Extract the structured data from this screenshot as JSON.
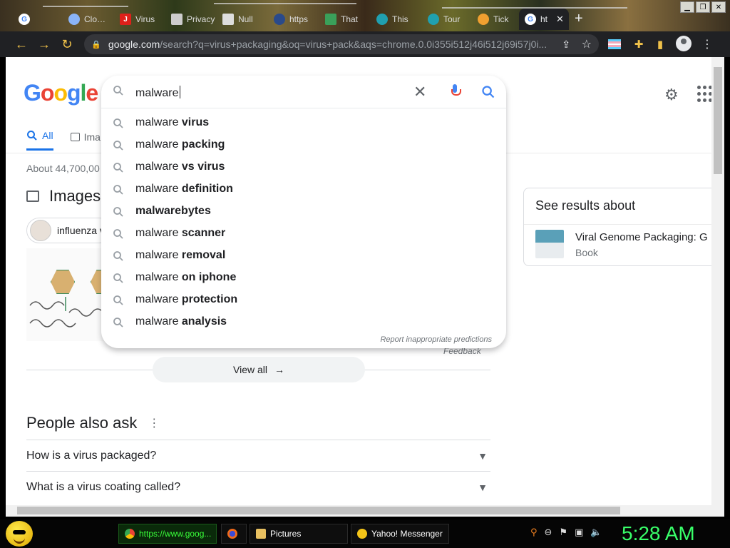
{
  "browser": {
    "tabs": [
      {
        "label": "",
        "favicon": "google-icon",
        "active": false
      },
      {
        "label": "Clo…",
        "favicon": "cloud-icon",
        "active": false
      },
      {
        "label": "Virus",
        "favicon": "j-icon",
        "active": false
      },
      {
        "label": "Privacy",
        "favicon": "page-icon",
        "active": false
      },
      {
        "label": "Null",
        "favicon": "page-icon",
        "active": false
      },
      {
        "label": "https",
        "favicon": "globe-icon",
        "active": false
      },
      {
        "label": "That",
        "favicon": "map-icon",
        "active": false
      },
      {
        "label": "This",
        "favicon": "gear-icon",
        "active": false
      },
      {
        "label": "Tour",
        "favicon": "gear-icon",
        "active": false
      },
      {
        "label": "Tick",
        "favicon": "face-icon",
        "active": false
      },
      {
        "label": "ht",
        "favicon": "google-icon",
        "active": true
      }
    ],
    "new_tab": "+",
    "address": {
      "host": "google.com",
      "path": "/search?q=virus+packaging&oq=virus+pack&aqs=chrome.0.0i355i512j46i512j69i57j0i..."
    }
  },
  "google": {
    "logo": "Google",
    "query": "malware",
    "suggestions": [
      {
        "prefix": "malware ",
        "bold": "virus"
      },
      {
        "prefix": "malware ",
        "bold": "packing"
      },
      {
        "prefix": "malware ",
        "bold": "vs virus"
      },
      {
        "prefix": "malware ",
        "bold": "definition"
      },
      {
        "prefix": "",
        "bold": "malwarebytes"
      },
      {
        "prefix": "malware ",
        "bold": "scanner"
      },
      {
        "prefix": "malware ",
        "bold": "removal"
      },
      {
        "prefix": "malware ",
        "bold": "on iphone"
      },
      {
        "prefix": "malware ",
        "bold": "protection"
      },
      {
        "prefix": "malware ",
        "bold": "analysis"
      }
    ],
    "report_link": "Report inappropriate predictions",
    "tabs": [
      {
        "label": "All"
      },
      {
        "label": "Ima"
      }
    ],
    "stats": "About 44,700,00",
    "images_heading": "Images",
    "chip_label": "influenza v",
    "feedback": "Feedback",
    "view_all": "View all",
    "people_also_ask": "People also ask",
    "questions": [
      "How is a virus packaged?",
      "What is a virus coating called?"
    ],
    "side_card": {
      "heading": "See results about",
      "title": "Viral Genome Packaging: G",
      "subtitle": "Book"
    }
  },
  "taskbar": {
    "items": [
      {
        "label": "https://www.goog...",
        "active": true
      },
      {
        "label": "",
        "active": false
      },
      {
        "label": "Pictures",
        "active": false
      },
      {
        "label": "Yahoo! Messenger",
        "active": false
      }
    ],
    "clock": "5:28 AM"
  },
  "colors": {
    "accent": "#1a73e8",
    "clock": "#39ff6a"
  }
}
